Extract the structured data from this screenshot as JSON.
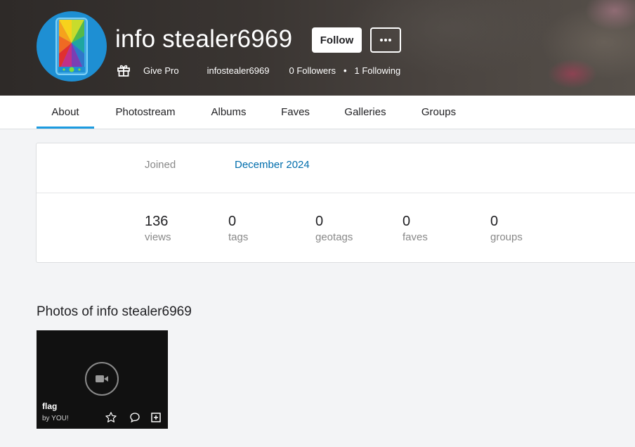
{
  "profile": {
    "display_name": "info stealer6969",
    "follow_label": "Follow",
    "give_pro_label": "Give Pro",
    "handle": "infostealer6969",
    "followers_text": "0 Followers",
    "separator": "•",
    "following_text": "1 Following"
  },
  "tabs": [
    {
      "label": "About",
      "active": true
    },
    {
      "label": "Photostream",
      "active": false
    },
    {
      "label": "Albums",
      "active": false
    },
    {
      "label": "Faves",
      "active": false
    },
    {
      "label": "Galleries",
      "active": false
    },
    {
      "label": "Groups",
      "active": false
    }
  ],
  "about": {
    "joined_label": "Joined",
    "joined_value": "December 2024",
    "stats": [
      {
        "value": "136",
        "label": "views"
      },
      {
        "value": "0",
        "label": "tags"
      },
      {
        "value": "0",
        "label": "geotags"
      },
      {
        "value": "0",
        "label": "faves"
      },
      {
        "value": "0",
        "label": "groups"
      }
    ]
  },
  "photos": {
    "section_title": "Photos of info stealer6969",
    "items": [
      {
        "title": "flag",
        "by": "by YOU!",
        "media_icon": "video-camera-icon"
      }
    ]
  },
  "colors": {
    "accent_tab": "#1c9be0",
    "link": "#006dac",
    "avatar_bg": "#1e8fd3"
  },
  "icons": [
    "gift-icon",
    "more-dots-icon",
    "video-camera-icon",
    "star-icon",
    "comment-icon",
    "add-to-icon"
  ]
}
